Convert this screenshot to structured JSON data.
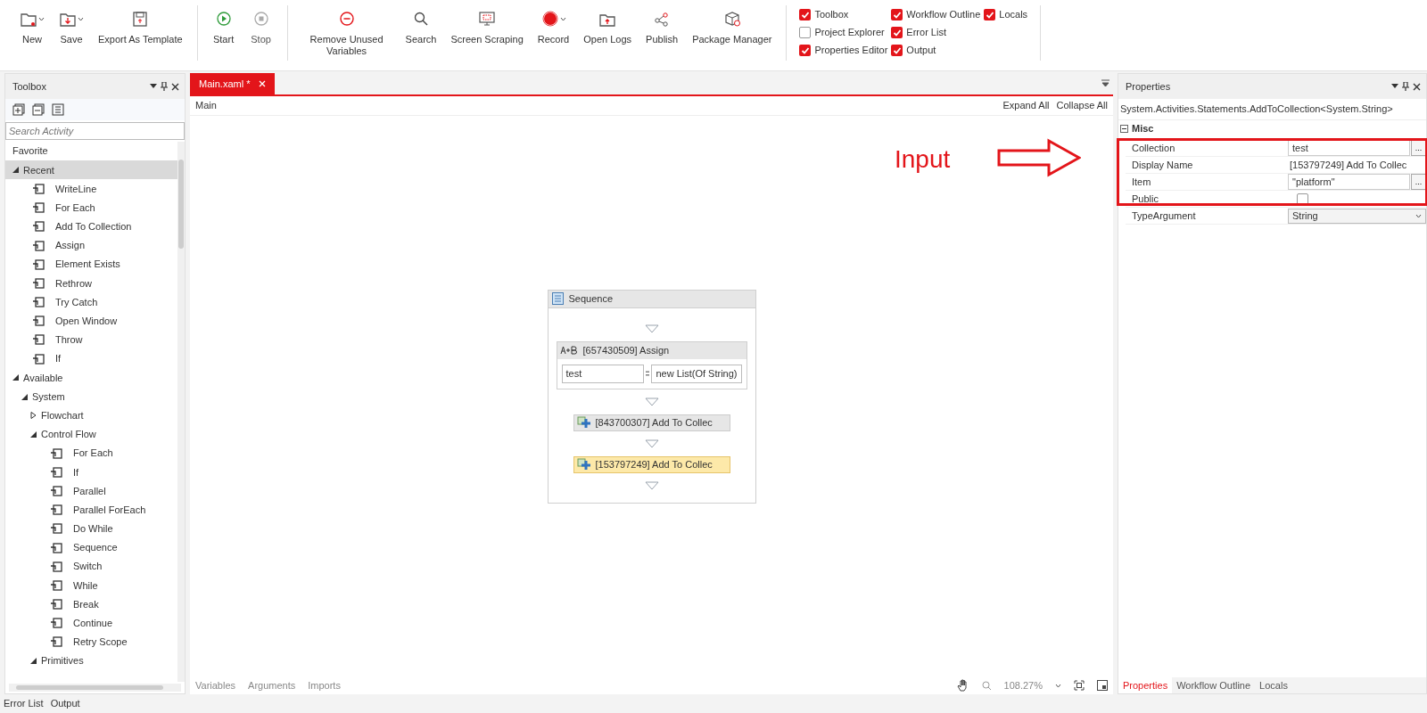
{
  "toolbar": {
    "groups": [
      [
        {
          "label": "New",
          "has_menu": true,
          "disabled": false
        },
        {
          "label": "Save",
          "has_menu": true,
          "disabled": false
        },
        {
          "label": "Export As Template",
          "has_menu": false,
          "disabled": false
        }
      ],
      [
        {
          "label": "Start",
          "has_menu": false,
          "disabled": false
        },
        {
          "label": "Stop",
          "has_menu": false,
          "disabled": true
        }
      ],
      [
        {
          "label": "Remove Unused Variables",
          "has_menu": false,
          "disabled": false
        },
        {
          "label": "Search",
          "has_menu": false,
          "disabled": false
        },
        {
          "label": "Screen Scraping",
          "has_menu": false,
          "disabled": false
        },
        {
          "label": "Record",
          "has_menu": true,
          "disabled": false
        },
        {
          "label": "Open Logs",
          "has_menu": false,
          "disabled": false
        },
        {
          "label": "Publish",
          "has_menu": false,
          "disabled": false
        },
        {
          "label": "Package Manager",
          "has_menu": false,
          "disabled": false
        }
      ]
    ],
    "panel_toggles": [
      [
        {
          "label": "Toolbox",
          "checked": true
        },
        {
          "label": "Project Explorer",
          "checked": false
        },
        {
          "label": "Properties Editor",
          "checked": true
        }
      ],
      [
        {
          "label": "Workflow Outline",
          "checked": true
        },
        {
          "label": "Error List",
          "checked": true
        },
        {
          "label": "Output",
          "checked": true
        }
      ],
      [
        {
          "label": "Locals",
          "checked": true
        }
      ]
    ]
  },
  "toolbox": {
    "title": "Toolbox",
    "search": {
      "placeholder": "Search Activity"
    },
    "tree": [
      {
        "kind": "category",
        "label": "Favorite",
        "selected": false
      },
      {
        "kind": "category",
        "label": "Recent",
        "selected": true,
        "expanded": true,
        "children": [
          {
            "kind": "activity",
            "label": "WriteLine",
            "selected": false
          },
          {
            "kind": "activity",
            "label": "For Each",
            "selected": false
          },
          {
            "kind": "activity",
            "label": "Add To Collection",
            "selected": false
          },
          {
            "kind": "activity",
            "label": "Assign",
            "selected": false
          },
          {
            "kind": "activity",
            "label": "Element Exists",
            "selected": false
          },
          {
            "kind": "activity",
            "label": "Rethrow",
            "selected": false
          },
          {
            "kind": "activity",
            "label": "Try Catch",
            "selected": false
          },
          {
            "kind": "activity",
            "label": "Open Window",
            "selected": false
          },
          {
            "kind": "activity",
            "label": "Throw",
            "selected": false
          },
          {
            "kind": "activity",
            "label": "If",
            "selected": false
          }
        ]
      },
      {
        "kind": "category",
        "label": "Available",
        "selected": false,
        "expanded": true,
        "children": [
          {
            "kind": "category",
            "label": "System",
            "selected": false,
            "expanded": true,
            "children": [
              {
                "kind": "category",
                "label": "Flowchart",
                "selected": false,
                "expanded": false
              },
              {
                "kind": "category",
                "label": "Control Flow",
                "selected": false,
                "expanded": true,
                "children": [
                  {
                    "kind": "activity",
                    "label": "For Each",
                    "selected": false
                  },
                  {
                    "kind": "activity",
                    "label": "If",
                    "selected": false
                  },
                  {
                    "kind": "activity",
                    "label": "Parallel",
                    "selected": false
                  },
                  {
                    "kind": "activity",
                    "label": "Parallel ForEach",
                    "selected": false
                  },
                  {
                    "kind": "activity",
                    "label": "Do While",
                    "selected": false
                  },
                  {
                    "kind": "activity",
                    "label": "Sequence",
                    "selected": false
                  },
                  {
                    "kind": "activity",
                    "label": "Switch",
                    "selected": false
                  },
                  {
                    "kind": "activity",
                    "label": "While",
                    "selected": false
                  },
                  {
                    "kind": "activity",
                    "label": "Break",
                    "selected": false
                  },
                  {
                    "kind": "activity",
                    "label": "Continue",
                    "selected": false
                  },
                  {
                    "kind": "activity",
                    "label": "Retry Scope",
                    "selected": false
                  }
                ]
              },
              {
                "kind": "category",
                "label": "Primitives",
                "selected": false,
                "expanded": true
              }
            ]
          }
        ]
      }
    ]
  },
  "designer": {
    "tabs": [
      {
        "label": "Main.xaml *",
        "selected": true
      }
    ],
    "breadcrumb": "Main",
    "expand_all": "Expand All",
    "collapse_all": "Collapse All",
    "sequence": {
      "title": "Sequence",
      "activities": [
        {
          "kind": "assign",
          "title": "[657430509] Assign",
          "to": "test",
          "value": "new List(Of String)",
          "selected": false
        },
        {
          "kind": "add",
          "title": "[843700307] Add To Collec",
          "selected": false
        },
        {
          "kind": "add",
          "title": "[153797249] Add To Collec",
          "selected": true
        }
      ]
    },
    "bottom_tabs": [
      "Variables",
      "Arguments",
      "Imports"
    ],
    "zoom": "108.27%"
  },
  "annotation": {
    "label": "Input"
  },
  "properties": {
    "title": "Properties",
    "type_name": "System.Activities.Statements.AddToCollection<System.String>",
    "category": "Misc",
    "rows": [
      {
        "kind": "expression",
        "name": "Collection",
        "value": "test",
        "button": "..."
      },
      {
        "kind": "text",
        "name": "Display Name",
        "value": "[153797249] Add To Collec"
      },
      {
        "kind": "expression",
        "name": "Item",
        "value": "\"platform\"",
        "button": "..."
      },
      {
        "kind": "checkbox",
        "name": "Public",
        "checked": false
      },
      {
        "kind": "dropdown",
        "name": "TypeArgument",
        "value": "String"
      }
    ],
    "tabs": [
      {
        "label": "Properties",
        "selected": true
      },
      {
        "label": "Workflow Outline",
        "selected": false
      },
      {
        "label": "Locals",
        "selected": false
      }
    ]
  },
  "status_bar": [
    "Error List",
    "Output"
  ]
}
